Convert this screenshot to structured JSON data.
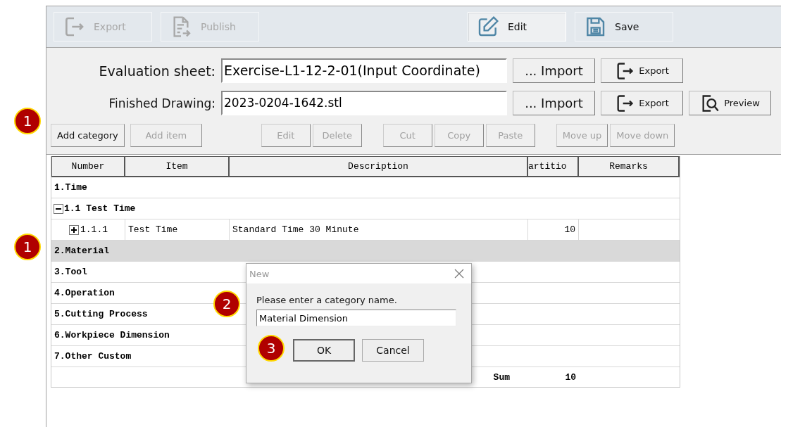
{
  "toolbar": [
    {
      "kind": "export",
      "label": "Export",
      "disabled": true,
      "pressed": false
    },
    {
      "kind": "publish",
      "label": "Publish",
      "disabled": true,
      "pressed": false
    },
    {
      "kind": "edit",
      "label": "Edit",
      "disabled": false,
      "pressed": true
    },
    {
      "kind": "save",
      "label": "Save",
      "disabled": false,
      "pressed": false
    }
  ],
  "fields": [
    {
      "label": "Evaluation sheet:",
      "value": "Exercise-L1-12-2-01(Input Coordinate)",
      "buttons": [
        {
          "kind": "import",
          "label": "... Import"
        },
        {
          "kind": "export",
          "label": "Export"
        }
      ]
    },
    {
      "label": "Finished Drawing:",
      "value": "2023-0204-1642.stl",
      "buttons": [
        {
          "kind": "import",
          "label": "... Import"
        },
        {
          "kind": "export",
          "label": "Export"
        },
        {
          "kind": "preview",
          "label": "Preview"
        }
      ]
    }
  ],
  "actions": [
    [
      {
        "label": "Add category",
        "disabled": false
      },
      {
        "label": "Add item",
        "disabled": true
      }
    ],
    [
      {
        "label": "Edit",
        "disabled": true
      },
      {
        "label": "Delete",
        "disabled": true
      }
    ],
    [
      {
        "label": "Cut",
        "disabled": true
      },
      {
        "label": "Copy",
        "disabled": true
      },
      {
        "label": "Paste",
        "disabled": true
      }
    ],
    [
      {
        "label": "Move up",
        "disabled": true
      },
      {
        "label": "Move down",
        "disabled": true
      }
    ]
  ],
  "table": {
    "columns": [
      "Number",
      "Item",
      "Description",
      "artitio",
      "Remarks"
    ],
    "rows": [
      {
        "kind": "category",
        "label": "1.Time",
        "selected": false,
        "children": [
          {
            "kind": "subcategory",
            "label": "1.1 Test Time",
            "expanded": true,
            "selected": false,
            "children": [
              {
                "kind": "item",
                "number": "1.1.1",
                "item": "Test Time",
                "description": "Standard Time 30 Minute",
                "partition": "10",
                "expanded": false,
                "selected": false
              }
            ]
          }
        ]
      },
      {
        "kind": "category",
        "label": "2.Material",
        "selected": true
      },
      {
        "kind": "category",
        "label": "3.Tool",
        "selected": false
      },
      {
        "kind": "category",
        "label": "4.Operation",
        "selected": false
      },
      {
        "kind": "category",
        "label": "5.Cutting Process",
        "selected": false
      },
      {
        "kind": "category",
        "label": "6.Workpiece Dimension",
        "selected": false
      },
      {
        "kind": "category",
        "label": "7.Other Custom",
        "selected": false
      }
    ],
    "sum": {
      "label": "Sum",
      "value": "10"
    }
  },
  "dialog": {
    "title": "New",
    "prompt": "Please enter a category name.",
    "value": "Material Dimension",
    "buttons": [
      {
        "label": "OK",
        "default": true
      },
      {
        "label": "Cancel",
        "default": false
      }
    ]
  },
  "callouts": [
    "1",
    "1",
    "2",
    "3"
  ]
}
